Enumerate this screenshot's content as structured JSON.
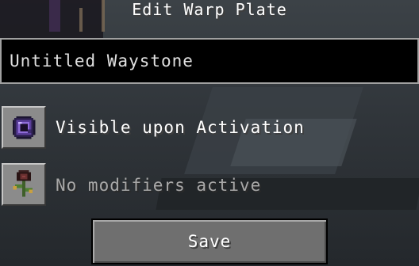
{
  "screen": {
    "title": "Edit Warp Plate"
  },
  "name_field": {
    "value": "Untitled Waystone"
  },
  "visibility_option": {
    "icon": "ender-eye-icon",
    "label": "Visible upon Activation"
  },
  "modifiers_option": {
    "icon": "wither-rose-icon",
    "label": "No modifiers active"
  },
  "save_button": {
    "label": "Save"
  },
  "colors": {
    "text_primary": "#ffffff",
    "text_disabled": "#a8a8a8",
    "input_background": "#000000",
    "button_background": "#6f6f6f"
  }
}
